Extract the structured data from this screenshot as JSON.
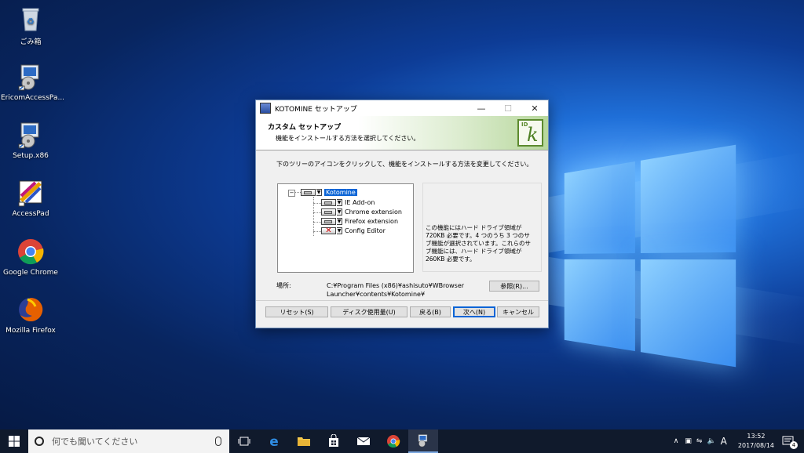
{
  "desktop": {
    "icons": [
      {
        "label": "ごみ箱",
        "icon": "recycle-bin-icon"
      },
      {
        "label": "EricomAccessPa...",
        "icon": "installer-icon"
      },
      {
        "label": "Setup.x86",
        "icon": "installer-icon"
      },
      {
        "label": "AccessPad",
        "icon": "accesspad-icon"
      },
      {
        "label": "Google Chrome",
        "icon": "chrome-icon"
      },
      {
        "label": "Mozilla Firefox",
        "icon": "firefox-icon"
      }
    ]
  },
  "dialog": {
    "title": "KOTOMINE セットアップ",
    "header_title": "カスタム セットアップ",
    "header_subtitle": "機能をインストールする方法を選択してください。",
    "logo_id": "ID",
    "logo_letter": "k",
    "instruction": "下のツリーのアイコンをクリックして、機能をインストールする方法を変更してください。",
    "tree": {
      "root": "Kotomine",
      "children": [
        "IE Add-on",
        "Chrome extension",
        "Firefox extension",
        "Config Editor"
      ]
    },
    "description": "この機能にはハード ドライブ領域が 720KB 必要です。4 つのうち 3 つのサブ機能が選択されています。これらのサブ機能には、ハード ドライブ領域が 260KB 必要です。",
    "location_label": "場所:",
    "location_path": "C:¥Program Files (x86)¥ashisuto¥WBrowser Launcher¥contents¥Kotomine¥",
    "buttons": {
      "browse": "参照(R)...",
      "reset": "リセット(S)",
      "disk_usage": "ディスク使用量(U)",
      "back": "戻る(B)",
      "next": "次へ(N)",
      "cancel": "キャンセル"
    },
    "title_controls": {
      "minimize": "—",
      "maximize": "☐",
      "close": "✕"
    }
  },
  "taskbar": {
    "search_placeholder": "何でも聞いてください",
    "time": "13:52",
    "date": "2017/08/14",
    "ime": "A",
    "notification_count": "4"
  },
  "colors": {
    "accent": "#0a64d6",
    "header_green": "#b7d79c",
    "taskbar": "#101a2c"
  }
}
